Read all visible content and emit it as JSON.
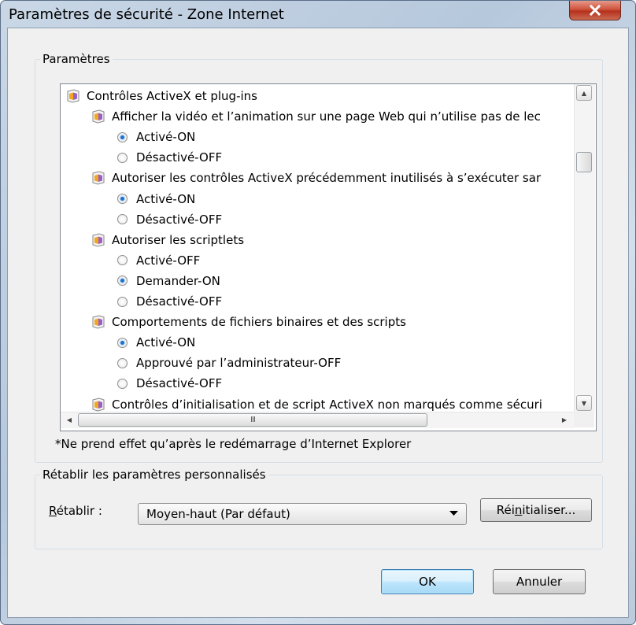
{
  "window": {
    "title": "Paramètres de sécurité - Zone Internet",
    "close_icon": "close-icon"
  },
  "settings_group": {
    "label": "Paramètres",
    "tree": {
      "category": "Contrôles ActiveX et plug-ins",
      "items": [
        {
          "label": "Afficher la vidéo et l’animation sur une page Web qui n’utilise pas de lec",
          "options": [
            {
              "label": "Activé-ON",
              "selected": true
            },
            {
              "label": "Désactivé-OFF",
              "selected": false
            }
          ]
        },
        {
          "label": "Autoriser les contrôles ActiveX précédemment inutilisés à s’exécuter sar",
          "options": [
            {
              "label": "Activé-ON",
              "selected": true
            },
            {
              "label": "Désactivé-OFF",
              "selected": false
            }
          ]
        },
        {
          "label": "Autoriser les scriptlets",
          "options": [
            {
              "label": "Activé-OFF",
              "selected": false
            },
            {
              "label": "Demander-ON",
              "selected": true
            },
            {
              "label": "Désactivé-OFF",
              "selected": false
            }
          ]
        },
        {
          "label": "Comportements de fichiers binaires et des scripts",
          "options": [
            {
              "label": "Activé-ON",
              "selected": true
            },
            {
              "label": "Approuvé par l’administrateur-OFF",
              "selected": false
            },
            {
              "label": "Désactivé-OFF",
              "selected": false
            }
          ]
        },
        {
          "label": "Contrôles d’initialisation et de script ActiveX non marqués comme sécuri",
          "options": []
        }
      ]
    },
    "hscroll_grip": "III"
  },
  "note": "*Ne prend effet qu’après le redémarrage d’Internet Explorer",
  "reset_group": {
    "label": "Rétablir les paramètres personnalisés",
    "reset_label_mnemonic": "R",
    "reset_label_rest": "établir :",
    "combo_value": "Moyen-haut (Par défaut)",
    "reset_button_pre": "Réi",
    "reset_button_mnemonic": "n",
    "reset_button_post": "itialiser..."
  },
  "buttons": {
    "ok": "OK",
    "cancel": "Annuler"
  },
  "colors": {
    "radio_selected": "#1f6fcf",
    "close_button": "#c8412a",
    "default_button": "#3c7fb1"
  }
}
